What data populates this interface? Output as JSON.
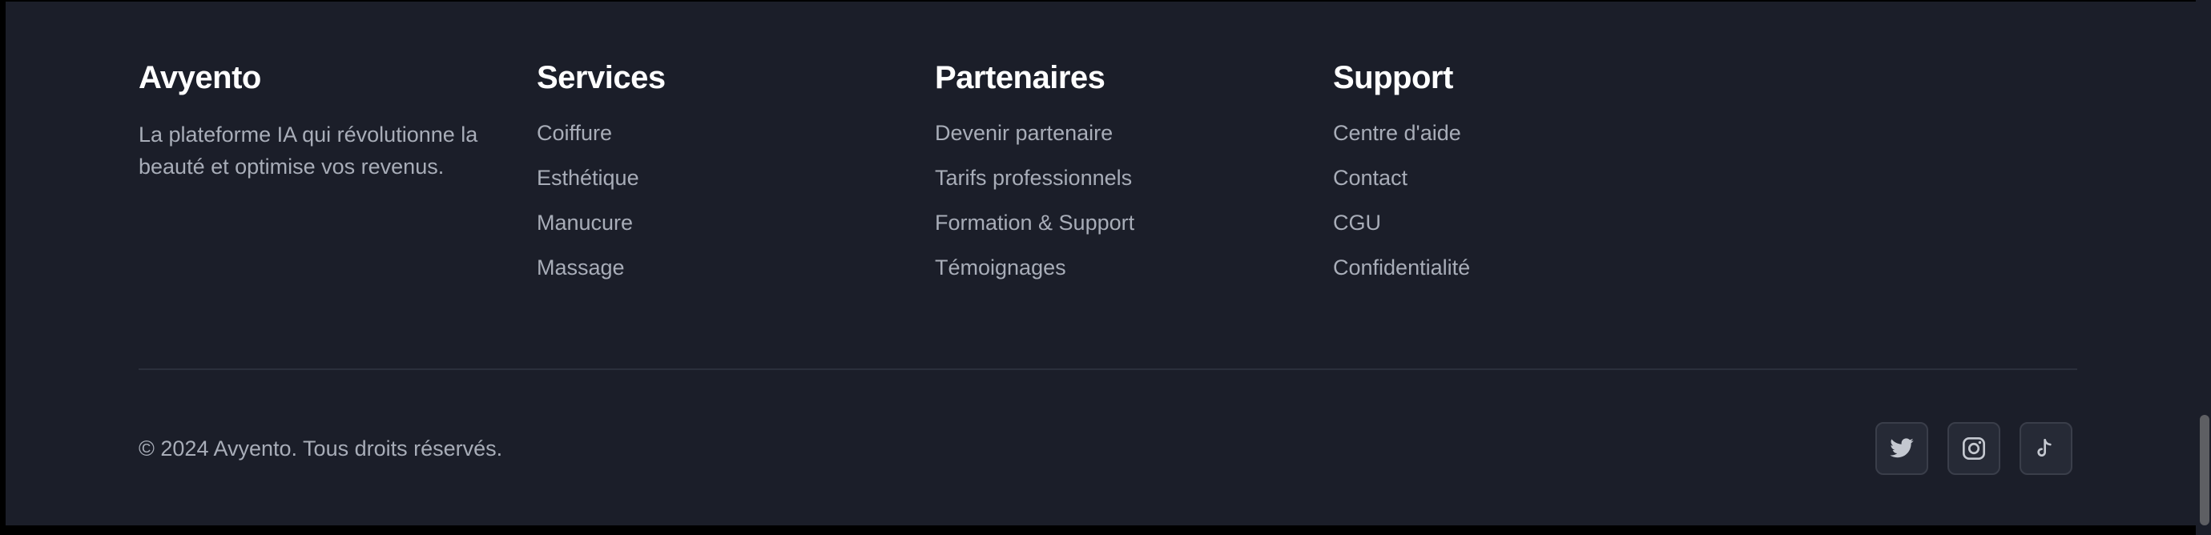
{
  "brand": {
    "name": "Avyento",
    "description": "La plateforme IA qui révolutionne la beauté et optimise vos revenus."
  },
  "columns": [
    {
      "title": "Services",
      "links": [
        "Coiffure",
        "Esthétique",
        "Manucure",
        "Massage"
      ]
    },
    {
      "title": "Partenaires",
      "links": [
        "Devenir partenaire",
        "Tarifs professionnels",
        "Formation & Support",
        "Témoignages"
      ]
    },
    {
      "title": "Support",
      "links": [
        "Centre d'aide",
        "Contact",
        "CGU",
        "Confidentialité"
      ]
    }
  ],
  "copyright": "© 2024 Avyento. Tous droits réservés.",
  "socials": [
    {
      "icon": "twitter-icon"
    },
    {
      "icon": "instagram-icon"
    },
    {
      "icon": "tiktok-icon"
    }
  ],
  "colors": {
    "background": "#1b1e29",
    "heading": "#ffffff",
    "text": "#a8adb8",
    "divider": "#2b2f3b"
  }
}
